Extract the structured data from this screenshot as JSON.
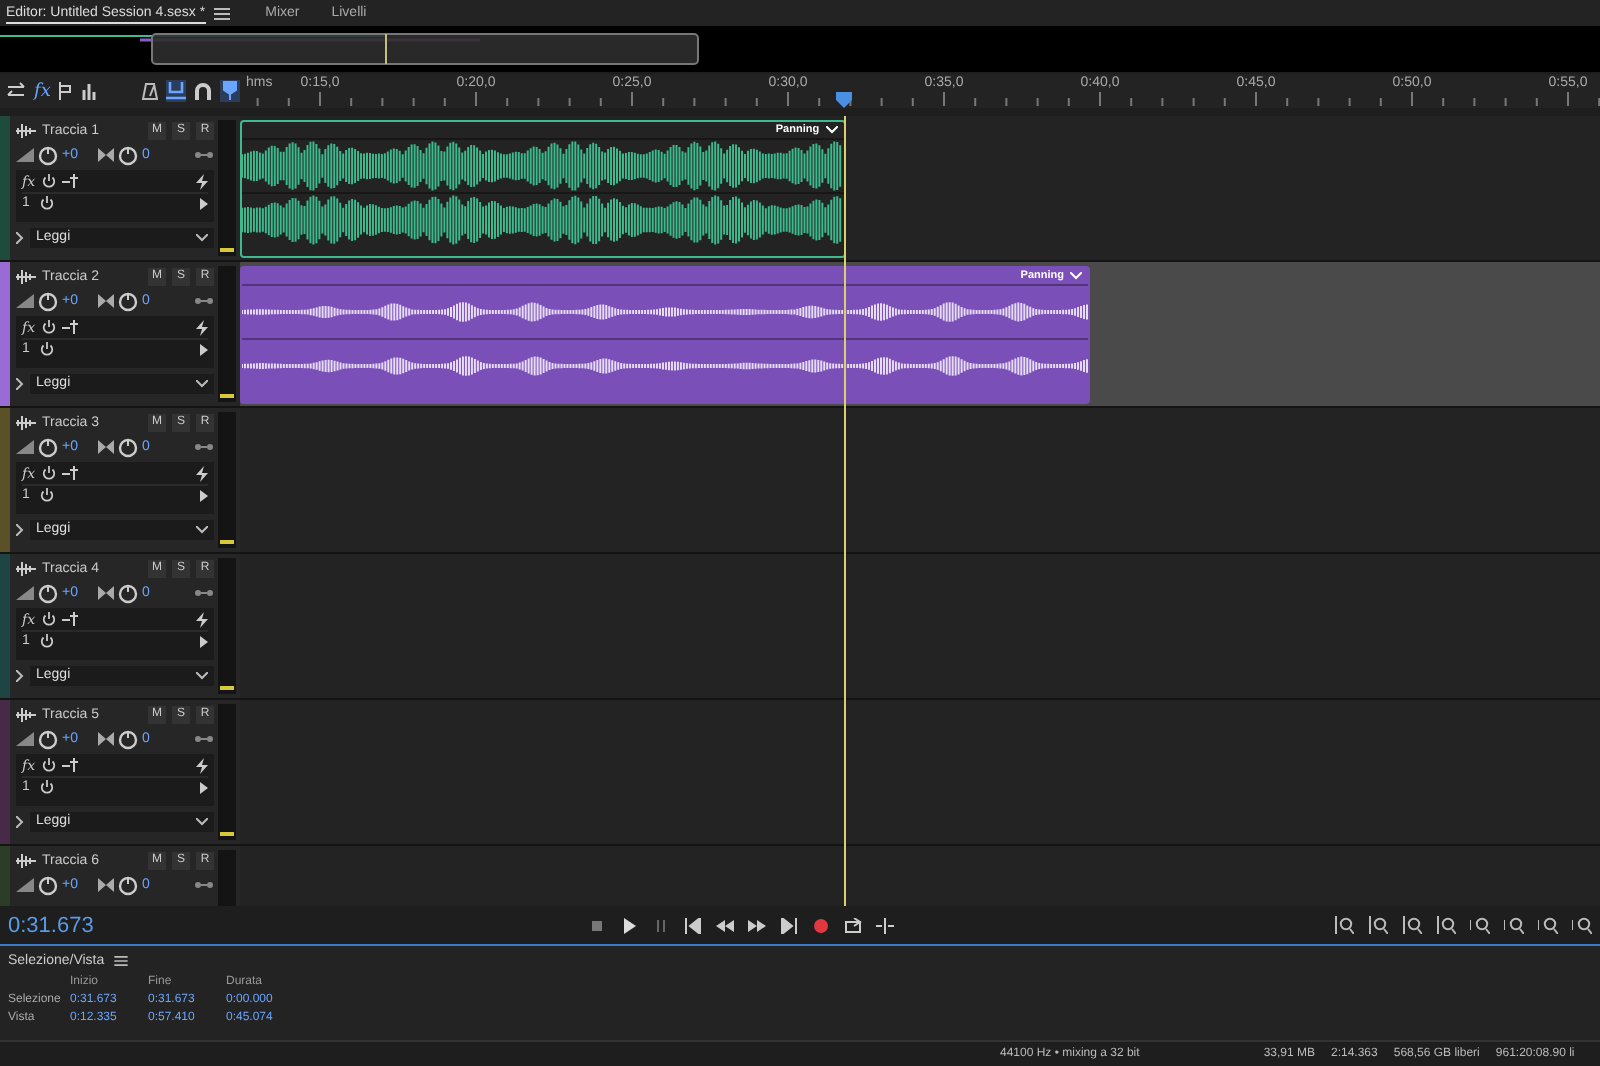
{
  "tabs": [
    {
      "label": "Editor: Untitled Session 4.sesx *",
      "selected": true
    },
    {
      "label": "Mixer",
      "selected": false
    },
    {
      "label": "Livelli",
      "selected": false
    }
  ],
  "toolbar": {
    "fx": "fx"
  },
  "ruler": {
    "unit": "hms",
    "labels": [
      "0:15,0",
      "0:20,0",
      "0:25,0",
      "0:30,0",
      "0:35,0",
      "0:40,0",
      "0:45,0",
      "0:50,0",
      "0:55,0"
    ]
  },
  "playhead": {
    "level": 0.444
  },
  "tracks": [
    {
      "name": "Traccia 1",
      "color": "#1f4b3d",
      "selected": false,
      "buttons": [
        "M",
        "S",
        "R"
      ],
      "volume": "+0",
      "pan": "0",
      "fx": "fx",
      "slot": "1",
      "automation": "Leggi",
      "clip": {
        "label": "Panning",
        "kind": "dense",
        "color": "#3dbb8f",
        "level": 0.445
      }
    },
    {
      "name": "Traccia 2",
      "color": "#9a6bd4",
      "selected": true,
      "buttons": [
        "M",
        "S",
        "R"
      ],
      "volume": "+0",
      "pan": "0",
      "fx": "fx",
      "slot": "1",
      "automation": "Leggi",
      "clip": {
        "label": "Panning",
        "kind": "sparse",
        "color": "#7a4fb8",
        "level": 0.625
      }
    },
    {
      "name": "Traccia 3",
      "color": "#5a5226",
      "selected": false,
      "buttons": [
        "M",
        "S",
        "R"
      ],
      "volume": "+0",
      "pan": "0",
      "fx": "fx",
      "slot": "1",
      "automation": "Leggi"
    },
    {
      "name": "Traccia 4",
      "color": "#1e4444",
      "selected": false,
      "buttons": [
        "M",
        "S",
        "R"
      ],
      "volume": "+0",
      "pan": "0",
      "fx": "fx",
      "slot": "1",
      "automation": "Leggi"
    },
    {
      "name": "Traccia 5",
      "color": "#472a47",
      "selected": false,
      "buttons": [
        "M",
        "S",
        "R"
      ],
      "volume": "+0",
      "pan": "0",
      "fx": "fx",
      "slot": "1",
      "automation": "Leggi"
    },
    {
      "name": "Traccia 6",
      "color": "#2b3d26",
      "selected": false,
      "buttons": [
        "M",
        "S",
        "R"
      ],
      "volume": "+0",
      "pan": "0"
    }
  ],
  "time": "0:31.673",
  "selection_panel": {
    "title": "Selezione/Vista",
    "columns": [
      "Inizio",
      "Fine",
      "Durata"
    ],
    "rows": [
      {
        "label": "Selezione",
        "values": [
          "0:31.673",
          "0:31.673",
          "0:00.000"
        ]
      },
      {
        "label": "Vista",
        "values": [
          "0:12.335",
          "0:57.410",
          "0:45.074"
        ]
      }
    ]
  },
  "status_bar": [
    "44100 Hz • mixing a 32 bit",
    "33,91 MB",
    "2:14.363",
    "568,56 GB liberi",
    "961:20:08.90 li"
  ]
}
